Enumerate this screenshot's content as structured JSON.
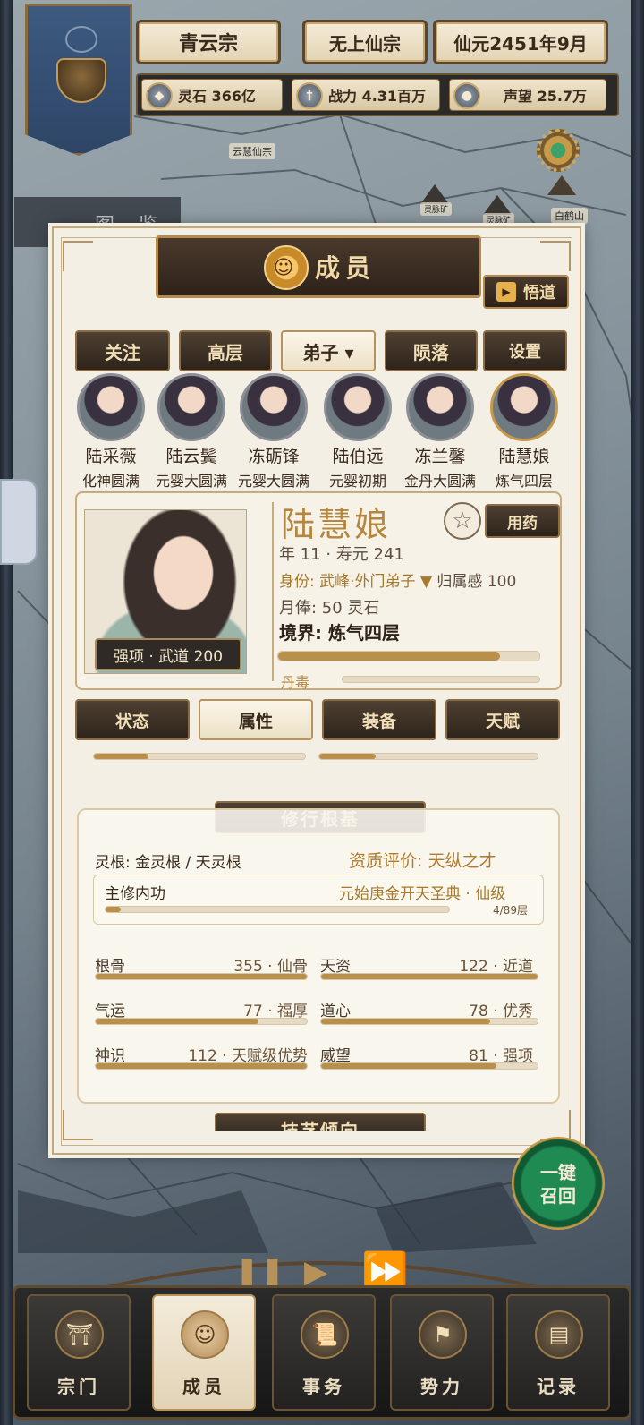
{
  "hud": {
    "sect_name": "青云宗",
    "sect_rank": "无上仙宗",
    "date": "仙元2451年9月",
    "resources": [
      {
        "icon": "spirit-stone-icon",
        "text": "灵石 366亿"
      },
      {
        "icon": "sword-icon",
        "text": "战力 4.31百万"
      },
      {
        "icon": "reputation-icon",
        "text": "声望 25.7万"
      }
    ]
  },
  "map": {
    "labels": [
      "云慧仙宗",
      "灵脉矿",
      "灵脉矿",
      "白鹤山"
    ],
    "tujian": "图 鉴"
  },
  "dialog": {
    "title": "成员",
    "wudao_label": "悟道",
    "tabs": [
      {
        "label": "关注"
      },
      {
        "label": "高层"
      },
      {
        "label": "弟子 ▾"
      },
      {
        "label": "陨落"
      },
      {
        "label": "设置"
      }
    ],
    "selected_tab": "弟子",
    "members": [
      {
        "name": "陆采薇",
        "level": "化神圆满"
      },
      {
        "name": "陆云鬓",
        "level": "元婴大圆满"
      },
      {
        "name": "冻砺锋",
        "level": "元婴大圆满"
      },
      {
        "name": "陆伯远",
        "level": "元婴初期"
      },
      {
        "name": "冻兰馨",
        "level": "金丹大圆满"
      },
      {
        "name": "陆慧娘",
        "level": "炼气四层"
      }
    ],
    "detail": {
      "name": "陆慧娘",
      "strength_tag": "强项 · 武道 200",
      "age_line": "年 11 · 寿元 241",
      "identity_label": "身份: ",
      "identity_value": "武峰·外门弟子 ▼",
      "belonging": " 归属感 100",
      "salary": "月俸: 50 灵石",
      "realm": "境界: 炼气四层",
      "realm_progress": 0.85,
      "dandu_label": "丹毒",
      "dandu_progress": 0.0,
      "star_icon": "star-icon",
      "medicine_label": "用药"
    },
    "sub_tabs": [
      "状态",
      "属性",
      "装备",
      "天赋"
    ],
    "selected_sub_tab": "属性",
    "section": {
      "title": "修行根基",
      "linggen": "灵根: 金灵根 / 天灵根",
      "zizhi": "资质评价: 天纵之才",
      "gongfa_label": "主修内功",
      "gongfa_name": "元始庚金开天圣典 · 仙级",
      "gongfa_progress_text": "4/89层",
      "gongfa_progress": 0.045,
      "attributes": [
        {
          "name": "根骨",
          "value": "355 · 仙骨",
          "fill": 1.0
        },
        {
          "name": "天资",
          "value": "122 · 近道",
          "fill": 1.0
        },
        {
          "name": "气运",
          "value": "77 · 福厚",
          "fill": 0.77
        },
        {
          "name": "道心",
          "value": "78 · 优秀",
          "fill": 0.78
        },
        {
          "name": "神识",
          "value": "112 · 天赋级优势",
          "fill": 1.0
        },
        {
          "name": "威望",
          "value": "81 · 强项",
          "fill": 0.81
        }
      ],
      "next_title": "技艺倾向"
    }
  },
  "recall_label": "一键召回",
  "nav": [
    {
      "label": "宗门",
      "icon": "sect-icon"
    },
    {
      "label": "成员",
      "icon": "member-icon"
    },
    {
      "label": "事务",
      "icon": "scroll-icon"
    },
    {
      "label": "势力",
      "icon": "banner-icon"
    },
    {
      "label": "记录",
      "icon": "book-icon"
    }
  ],
  "selected_nav": "成员",
  "colors": {
    "accent_gold": "#b4863f",
    "panel_dark": "#2e241b",
    "recall_green": "#1f8a52"
  }
}
